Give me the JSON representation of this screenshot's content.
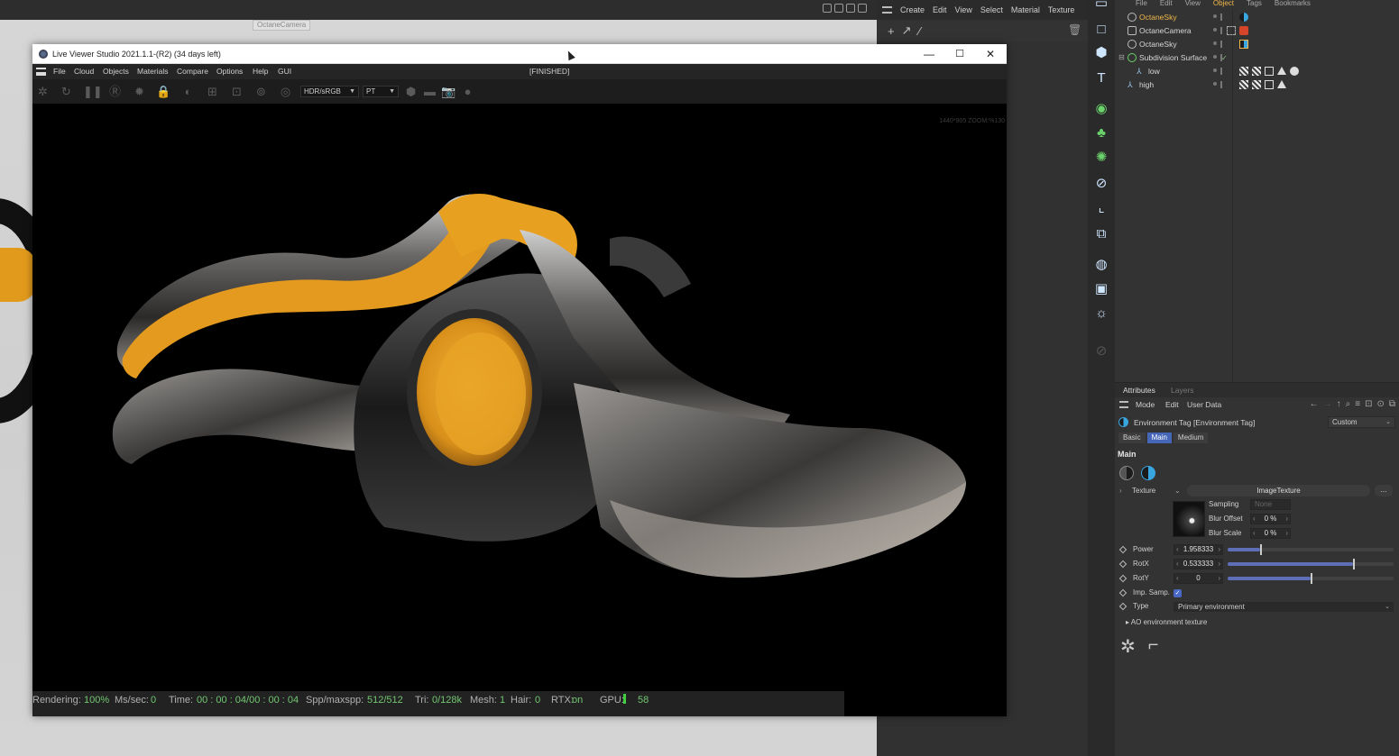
{
  "background_viewport": {
    "camera_label": "OctaneCamera"
  },
  "c4d_menubar": {
    "items": [
      "Create",
      "Edit",
      "View",
      "Select",
      "Material",
      "Texture"
    ]
  },
  "object_manager": {
    "menu": [
      "File",
      "Edit",
      "View",
      "Object",
      "Tags",
      "Bookmarks"
    ],
    "active_menu": "Object",
    "rows": [
      {
        "name": "OctaneSky",
        "selected": true
      },
      {
        "name": "OctaneCamera",
        "selected": false
      },
      {
        "name": "OctaneSky",
        "selected": false
      },
      {
        "name": "Subdivision Surface",
        "selected": false
      },
      {
        "name": "low",
        "selected": false
      },
      {
        "name": "high",
        "selected": false
      }
    ]
  },
  "attributes": {
    "tabs": [
      "Attributes",
      "Layers"
    ],
    "menu": [
      "Mode",
      "Edit",
      "User Data"
    ],
    "tag_title": "Environment Tag [Environment Tag]",
    "preset": "Custom",
    "subtabs": [
      "Basic",
      "Main",
      "Medium"
    ],
    "active_subtab": "Main",
    "section": "Main",
    "texture_label": "Texture",
    "texture_value": "ImageTexture",
    "more_button": "...",
    "sampling_label": "Sampling",
    "sampling_value": "None",
    "blur_offset_label": "Blur Offset",
    "blur_offset_value": "0 %",
    "blur_scale_label": "Blur Scale",
    "blur_scale_value": "0 %",
    "power_label": "Power",
    "power_value": "1.958333",
    "rotx_label": "RotX",
    "rotx_value": "0.533333",
    "roty_label": "RotY",
    "roty_value": "0",
    "imp_samp_label": "Imp. Samp.",
    "imp_samp_checked": true,
    "type_label": "Type",
    "type_value": "Primary environment",
    "ao_label": "AO environment texture"
  },
  "viewer": {
    "title": "Live Viewer Studio 2021.1.1-(R2) (34 days left)",
    "menu": [
      "File",
      "Cloud",
      "Objects",
      "Materials",
      "Compare",
      "Options",
      "Help",
      "GUI"
    ],
    "state": "[FINISHED]",
    "color_space": "HDR/sRGB",
    "kernel": "PT",
    "resolution_readout": "1440*905 ZOOM:%130",
    "status": {
      "rendering_label": "Rendering:",
      "rendering_value": "100%",
      "mssec_label": "Ms/sec:",
      "mssec_value": "0",
      "time_label": "Time:",
      "time_value": "00 : 00 : 04/00 : 00 : 04",
      "spp_label": "Spp/maxspp:",
      "spp_value": "512/512",
      "tri_label": "Tri:",
      "tri_value": "0/128k",
      "mesh_label": "Mesh:",
      "mesh_value": "1",
      "hair_label": "Hair:",
      "hair_value": "0",
      "rtx_label": "RTX:",
      "rtx_value": "on",
      "gpu_label": "GPU:",
      "gpu_value": "58"
    }
  },
  "colors": {
    "accent_orange": "#f0b84a",
    "octane_blue": "#4667b8",
    "status_green": "#72c672",
    "pliers_orange": "#e8a020"
  }
}
